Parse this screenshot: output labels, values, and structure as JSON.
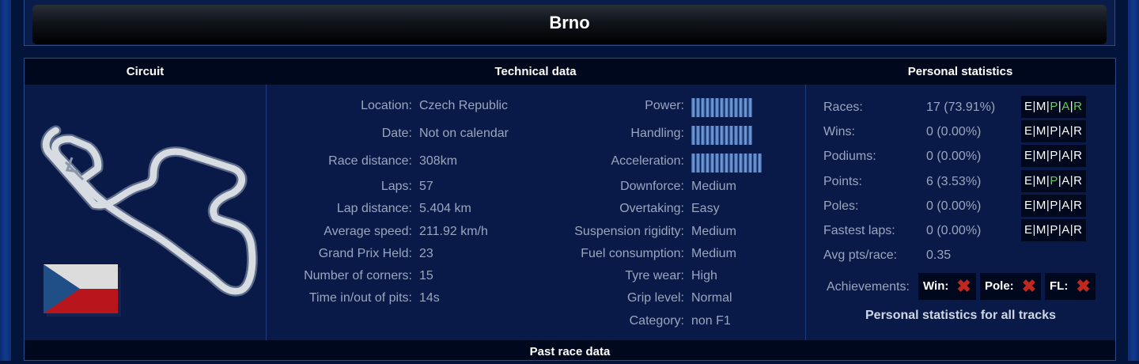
{
  "title": "Brno",
  "headers": {
    "circuit": "Circuit",
    "technical": "Technical data",
    "personal": "Personal statistics"
  },
  "technical_left": [
    {
      "label": "Location:",
      "value": "Czech Republic"
    },
    {
      "label": "Date:",
      "value": "Not on calendar"
    },
    {
      "label": "Race distance:",
      "value": "308km"
    },
    {
      "label": "Laps:",
      "value": "57"
    },
    {
      "label": "Lap distance:",
      "value": "5.404 km"
    },
    {
      "label": "Average speed:",
      "value": "211.92 km/h"
    },
    {
      "label": "Grand Prix Held:",
      "value": "23"
    },
    {
      "label": "Number of corners:",
      "value": "15"
    },
    {
      "label": "Time in/out of pits:",
      "value": "14s"
    }
  ],
  "technical_right": [
    {
      "label": "Power:",
      "bars": 13
    },
    {
      "label": "Handling:",
      "bars": 13
    },
    {
      "label": "Acceleration:",
      "bars": 15
    },
    {
      "label": "Downforce:",
      "value": "Medium"
    },
    {
      "label": "Overtaking:",
      "value": "Easy"
    },
    {
      "label": "Suspension rigidity:",
      "value": "Medium"
    },
    {
      "label": "Fuel consumption:",
      "value": "Medium"
    },
    {
      "label": "Tyre wear:",
      "value": "High"
    },
    {
      "label": "Grip level:",
      "value": "Normal"
    },
    {
      "label": "Category:",
      "value": "non F1"
    }
  ],
  "stats": [
    {
      "label": "Races:",
      "value": "17 (73.91%)",
      "empar": "E|M|P|A|R",
      "green": [
        "P",
        "A",
        "R"
      ]
    },
    {
      "label": "Wins:",
      "value": "0 (0.00%)",
      "empar": "E|M|P|A|R",
      "green": []
    },
    {
      "label": "Podiums:",
      "value": "0 (0.00%)",
      "empar": "E|M|P|A|R",
      "green": []
    },
    {
      "label": "Points:",
      "value": "6 (3.53%)",
      "empar": "E|M|P|A|R",
      "green": [
        "P"
      ]
    },
    {
      "label": "Poles:",
      "value": "0 (0.00%)",
      "empar": "E|M|P|A|R",
      "green": []
    },
    {
      "label": "Fastest laps:",
      "value": "0 (0.00%)",
      "empar": "E|M|P|A|R",
      "green": []
    },
    {
      "label": "Avg pts/race:",
      "value": "0.35"
    }
  ],
  "achievements": {
    "label": "Achievements:",
    "win": "Win:",
    "pole": "Pole:",
    "fl": "FL:",
    "mark": "✖"
  },
  "all_tracks_link": "Personal statistics for all tracks",
  "past_race": "Past race data",
  "colors": {
    "highlight": "#5ad64a",
    "cross": "#c0281e",
    "accent": "#113a8e"
  }
}
